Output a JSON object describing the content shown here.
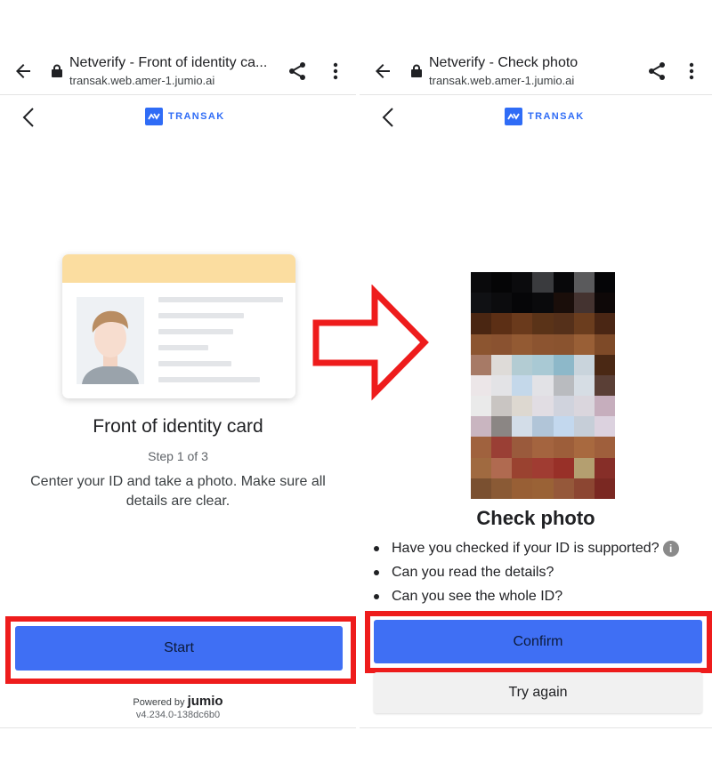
{
  "left": {
    "browser": {
      "title": "Netverify - Front of identity ca...",
      "url": "transak.web.amer-1.jumio.ai"
    },
    "logo_text": "TRANSAK",
    "heading": "Front of identity card",
    "step": "Step 1 of 3",
    "instructions": "Center your ID and take a photo. Make sure all details are clear.",
    "start_label": "Start",
    "powered_by": "Powered by",
    "brand": "jumio",
    "version": "v4.234.0-138dc6b0"
  },
  "right": {
    "browser": {
      "title": "Netverify - Check photo",
      "url": "transak.web.amer-1.jumio.ai"
    },
    "logo_text": "TRANSAK",
    "heading": "Check photo",
    "checklist": [
      "Have you checked if your ID is supported?",
      "Can you read the details?",
      "Can you see the whole ID?"
    ],
    "info_glyph": "i",
    "confirm_label": "Confirm",
    "try_again_label": "Try again"
  },
  "icons": [
    "back-arrow-icon",
    "lock-icon",
    "share-icon",
    "more-vert-icon",
    "chevron-left-icon",
    "transak-logo-icon",
    "info-icon",
    "arrow-right-icon"
  ],
  "colors": {
    "primary_button": "#3f6ff4",
    "highlight_border": "#ee1c1c",
    "card_band": "#fbdda0",
    "brand": "#2f6cf6"
  },
  "pixelated_photo": [
    [
      "#0a0a0c",
      "#050506",
      "#0b0b0d",
      "#3a3b3e",
      "#08080a",
      "#5a5a5c",
      "#050507"
    ],
    [
      "#101114",
      "#0c0c0e",
      "#060608",
      "#0a0a0c",
      "#1a0e0a",
      "#443330",
      "#0e0808"
    ],
    [
      "#4a2612",
      "#5c2f15",
      "#6a3a1c",
      "#5a3318",
      "#55301a",
      "#6b3d1e",
      "#4a2614"
    ],
    [
      "#8c5530",
      "#8a5230",
      "#935a33",
      "#8c5430",
      "#8a532f",
      "#995f36",
      "#7e4a28"
    ],
    [
      "#a77a66",
      "#dedbd8",
      "#b3ccd3",
      "#a9c9d4",
      "#8db8c9",
      "#c9d4dc",
      "#4a2814"
    ],
    [
      "#ece6e8",
      "#e3e3e6",
      "#c4d8ea",
      "#e2e2e6",
      "#b9bbbf",
      "#d6dde4",
      "#5a3f36"
    ],
    [
      "#eaeaea",
      "#c9c5c2",
      "#ddd8d0",
      "#e1dde3",
      "#d0d3dd",
      "#dad6dd",
      "#c6aebd"
    ],
    [
      "#c9b5c0",
      "#8b8684",
      "#d3dde8",
      "#b1c5d8",
      "#c3d8ee",
      "#c6ced8",
      "#dcd2df"
    ],
    [
      "#a0623e",
      "#9a3f35",
      "#9a5a3c",
      "#a4643f",
      "#9d5e3a",
      "#a8693f",
      "#9f5f3c"
    ],
    [
      "#a06a40",
      "#b06a50",
      "#9a4230",
      "#a03c32",
      "#983028",
      "#b49f70",
      "#862e28"
    ],
    [
      "#7a5030",
      "#8a5a35",
      "#985f35",
      "#9a6236",
      "#95583a",
      "#8c4632",
      "#7a2822"
    ]
  ]
}
